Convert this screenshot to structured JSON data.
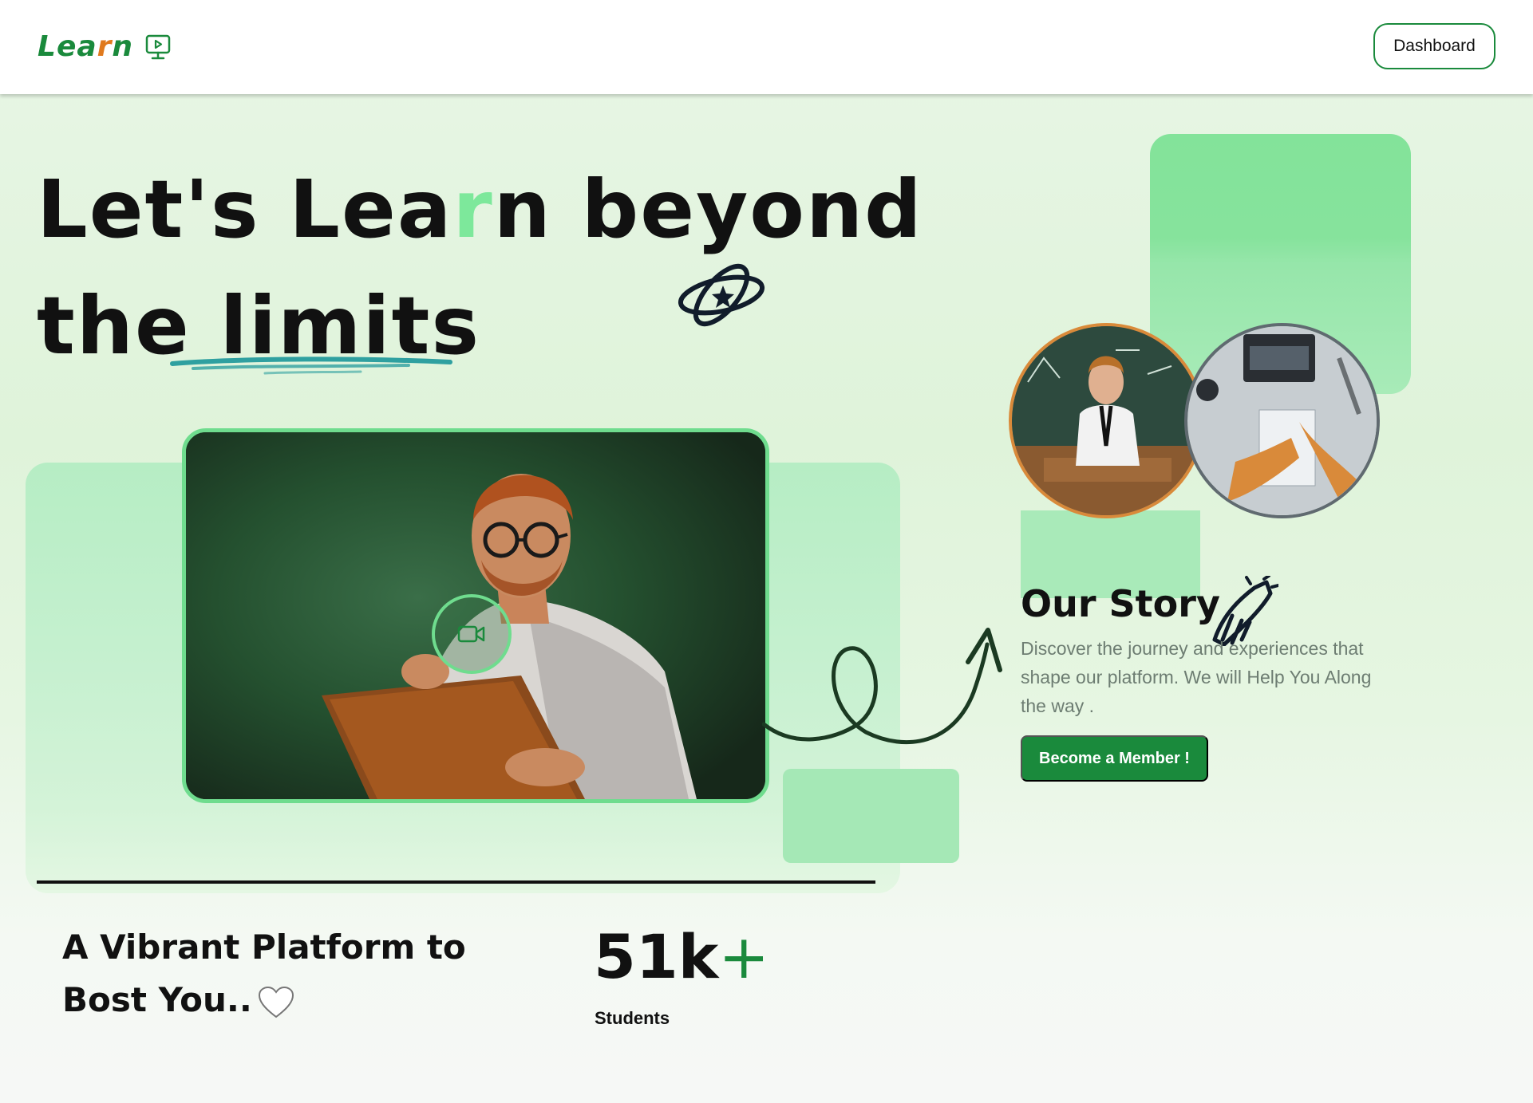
{
  "header": {
    "logo_text_start": "Lea",
    "logo_text_accent": "r",
    "logo_text_end": "n",
    "logo_icon": "monitor-play-icon",
    "dashboard_label": "Dashboard"
  },
  "hero": {
    "line1_a": "Let's Lea",
    "line1_hl": "r",
    "line1_b": "n beyond",
    "line2": "the limits",
    "decoration_icon": "atom-star-icon"
  },
  "video": {
    "play_icon": "video-camera-icon"
  },
  "story": {
    "title": "Our Story",
    "title_icon": "rocket-icon",
    "description": "Discover the journey and experiences that shape our platform. We will Help You Along the way .",
    "cta_label": "Become a Member !"
  },
  "bottom": {
    "tagline_line1": "A Vibrant Platform to",
    "tagline_line2": "Bost You..",
    "tagline_icon": "heart-icon",
    "stat_value": "51k",
    "stat_suffix": "+",
    "stat_label": "Students"
  },
  "colors": {
    "brand_green": "#1a8a3c",
    "accent_orange": "#e07a1e",
    "light_green": "#7de89b"
  }
}
